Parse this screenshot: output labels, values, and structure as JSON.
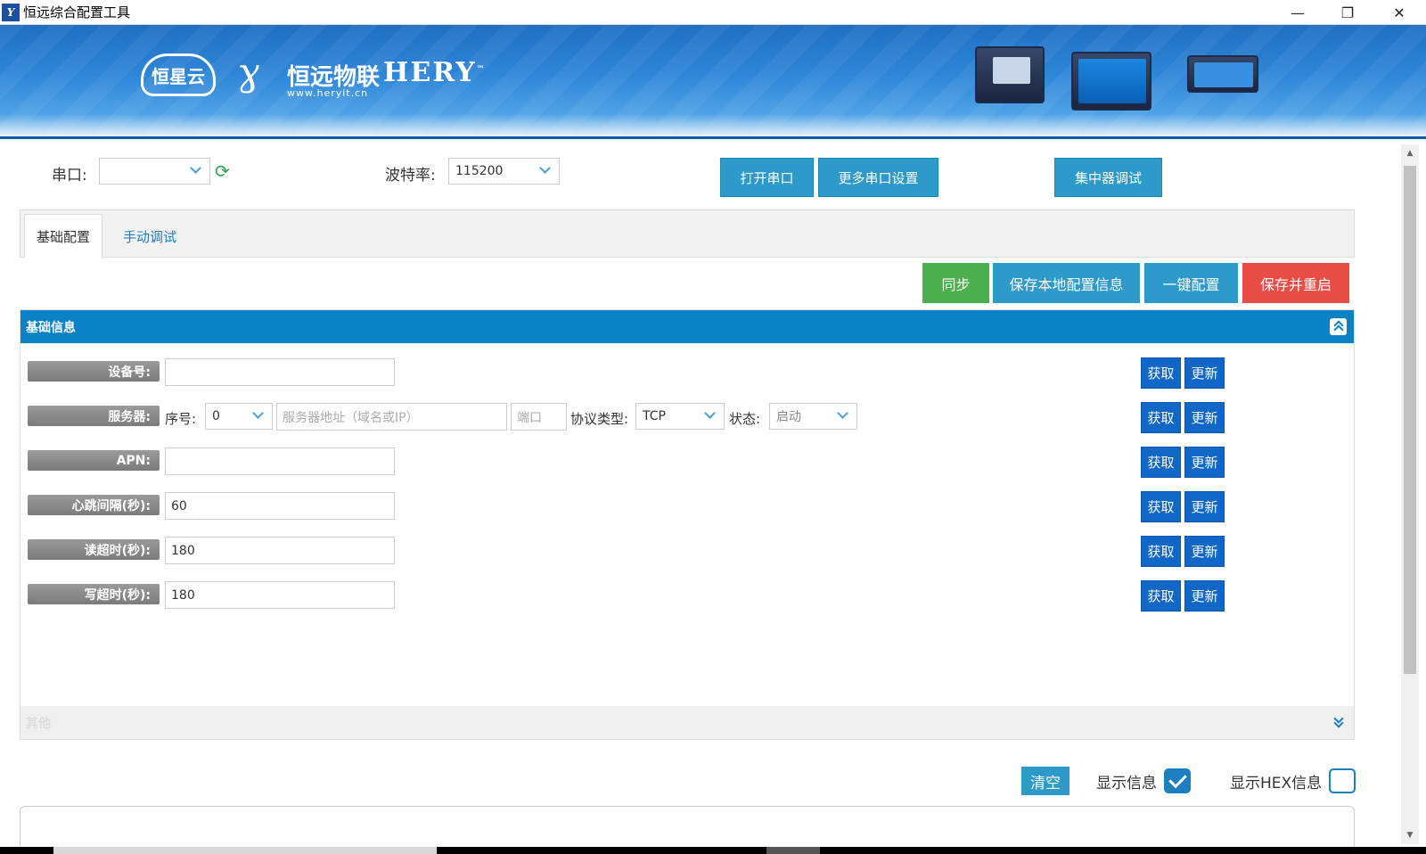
{
  "window": {
    "title": "恒远综合配置工具",
    "icon_text": "Y"
  },
  "banner": {
    "cloud_logo": "恒星云",
    "brand_name": "恒远物联",
    "brand_url": "www.heryit.cn",
    "hery": "HERY",
    "tm": "™"
  },
  "serial": {
    "port_label": "串口:",
    "port_value": "",
    "baud_label": "波特率:",
    "baud_value": "115200",
    "open_button": "打开串口",
    "more_button": "更多串口设置",
    "hub_button": "集中器调试"
  },
  "tabs": [
    {
      "label": "基础配置",
      "active": true
    },
    {
      "label": "手动调试",
      "active": false
    }
  ],
  "actions": {
    "sync": "同步",
    "save_local": "保存本地配置信息",
    "one_key": "一键配置",
    "save_restart": "保存并重启"
  },
  "colors": {
    "sync": "#4cae4c",
    "info": "#2d9ac9",
    "danger": "#e74c45",
    "header": "#0c82c6",
    "small_button": "#1167c8"
  },
  "basic_info": {
    "title": "基础信息",
    "get_label": "获取",
    "update_label": "更新",
    "rows": [
      {
        "label": "设备号:",
        "value": ""
      },
      {
        "label": "服务器:"
      },
      {
        "label": "APN:",
        "value": ""
      },
      {
        "label": "心跳间隔(秒):",
        "value": "60"
      },
      {
        "label": "读超时(秒):",
        "value": "180"
      },
      {
        "label": "写超时(秒):",
        "value": "180"
      }
    ],
    "server": {
      "index_label": "序号:",
      "index_value": "0",
      "address_placeholder": "服务器地址（域名或IP）",
      "port_placeholder": "端口",
      "protocol_label": "协议类型:",
      "protocol_value": "TCP",
      "state_label": "状态:",
      "state_value": "启动"
    }
  },
  "other": {
    "title": "其他"
  },
  "log": {
    "clear": "清空",
    "show_info": "显示信息",
    "show_info_checked": true,
    "show_hex": "显示HEX信息",
    "show_hex_checked": false
  }
}
